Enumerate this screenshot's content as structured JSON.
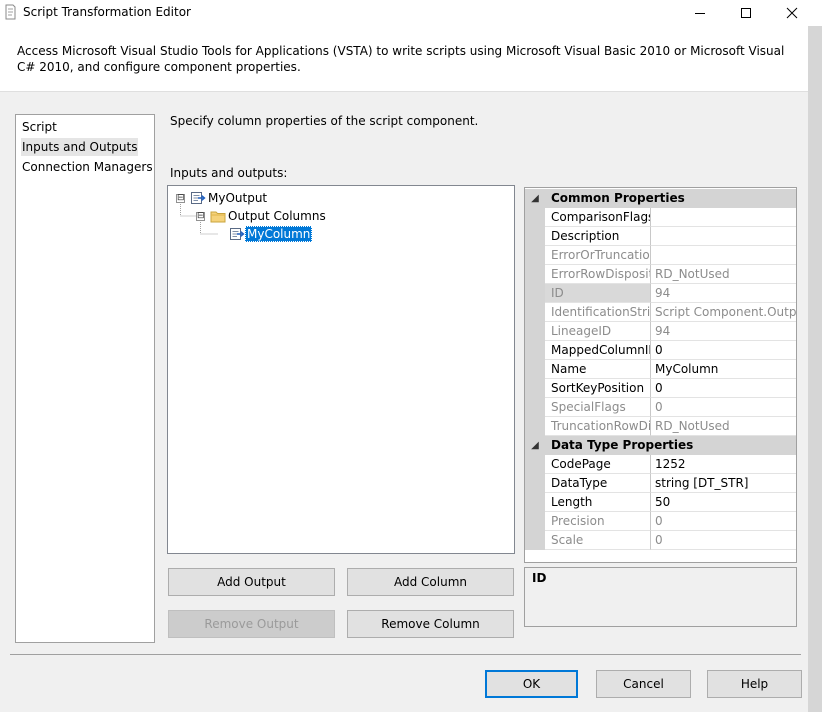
{
  "window": {
    "title": "Script Transformation Editor",
    "controls": {
      "minimize": "minimize-icon",
      "maximize": "maximize-icon",
      "close": "close-icon"
    }
  },
  "header": {
    "description": "Access Microsoft Visual Studio Tools for Applications (VSTA) to write scripts using Microsoft Visual Basic 2010 or Microsoft Visual C# 2010, and configure component properties."
  },
  "nav": {
    "items": [
      {
        "label": "Script",
        "selected": false
      },
      {
        "label": "Inputs and Outputs",
        "selected": true
      },
      {
        "label": "Connection Managers",
        "selected": false
      }
    ]
  },
  "main": {
    "caption": "Specify column properties of the script component.",
    "io_label": "Inputs and outputs:"
  },
  "tree": {
    "output": {
      "label": "MyOutput",
      "icon": "output-icon",
      "expander": "⊟"
    },
    "columns_folder": {
      "label": "Output Columns",
      "icon": "folder-icon",
      "expander": "⊟"
    },
    "column": {
      "label": "MyColumn",
      "icon": "column-icon",
      "selected": true
    }
  },
  "buttons": {
    "add_output": "Add Output",
    "add_column": "Add Column",
    "remove_output": "Remove Output",
    "remove_column": "Remove Column",
    "ok": "OK",
    "cancel": "Cancel",
    "help": "Help"
  },
  "properties": {
    "common": {
      "title": "Common Properties",
      "expander": "◢",
      "rows": [
        {
          "name": "ComparisonFlags",
          "value": "",
          "readonly": false
        },
        {
          "name": "Description",
          "value": "",
          "readonly": false
        },
        {
          "name": "ErrorOrTruncationOperation",
          "value": "",
          "readonly": true
        },
        {
          "name": "ErrorRowDisposition",
          "value": "RD_NotUsed",
          "readonly": true
        },
        {
          "name": "ID",
          "value": "94",
          "readonly": true,
          "selected": true
        },
        {
          "name": "IdentificationString",
          "value": "Script Component.Outputs[MyOutput].Columns[MyColumn]",
          "readonly": true
        },
        {
          "name": "LineageID",
          "value": "94",
          "readonly": true
        },
        {
          "name": "MappedColumnID",
          "value": "0",
          "readonly": false
        },
        {
          "name": "Name",
          "value": "MyColumn",
          "readonly": false
        },
        {
          "name": "SortKeyPosition",
          "value": "0",
          "readonly": false
        },
        {
          "name": "SpecialFlags",
          "value": "0",
          "readonly": true
        },
        {
          "name": "TruncationRowDisposition",
          "value": "RD_NotUsed",
          "readonly": true
        }
      ]
    },
    "datatype": {
      "title": "Data Type Properties",
      "expander": "◢",
      "rows": [
        {
          "name": "CodePage",
          "value": "1252",
          "readonly": false
        },
        {
          "name": "DataType",
          "value": "string [DT_STR]",
          "readonly": false
        },
        {
          "name": "Length",
          "value": "50",
          "readonly": false
        },
        {
          "name": "Precision",
          "value": "0",
          "readonly": true
        },
        {
          "name": "Scale",
          "value": "0",
          "readonly": true
        }
      ]
    }
  },
  "description_panel": {
    "title": "ID"
  }
}
